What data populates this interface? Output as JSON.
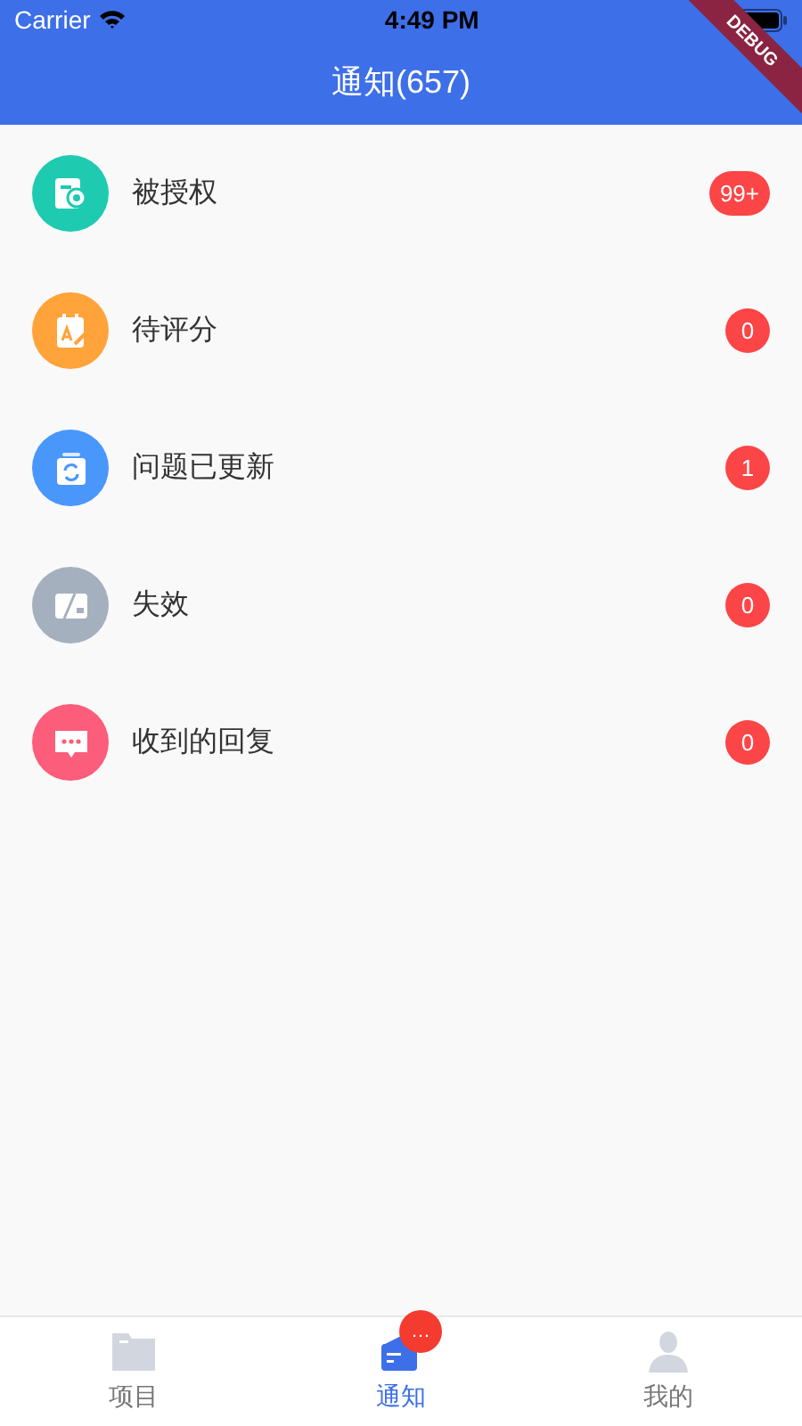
{
  "status_bar": {
    "carrier": "Carrier",
    "time": "4:49 PM"
  },
  "debug_banner": "DEBUG",
  "header": {
    "title": "通知(657)"
  },
  "items": [
    {
      "label": "被授权",
      "color": "#1ecbb0",
      "count": "99+"
    },
    {
      "label": "待评分",
      "color": "#ffa33a",
      "count": "0"
    },
    {
      "label": "问题已更新",
      "color": "#4a97fb",
      "count": "1"
    },
    {
      "label": "失效",
      "color": "#a5b0bf",
      "count": "0"
    },
    {
      "label": "收到的回复",
      "color": "#fb5d7a",
      "count": "0"
    }
  ],
  "tabs": [
    {
      "label": "项目",
      "selected": false
    },
    {
      "label": "通知",
      "selected": true,
      "badge": "…"
    },
    {
      "label": "我的",
      "selected": false
    }
  ]
}
